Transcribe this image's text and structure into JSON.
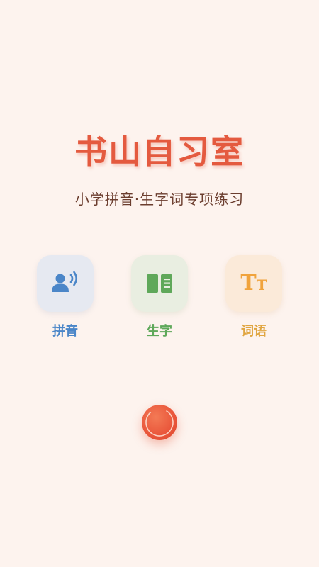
{
  "app": {
    "title": "书山自习室",
    "subtitle": "小学拼音·生字词专项练习"
  },
  "menu": {
    "items": [
      {
        "label": "拼音",
        "icon": "speaking-person-icon",
        "color": "#4b86c8"
      },
      {
        "label": "生字",
        "icon": "open-book-icon",
        "color": "#5fa85a"
      },
      {
        "label": "词语",
        "icon": "text-size-icon",
        "color": "#e0a540"
      }
    ]
  },
  "colors": {
    "background": "#fdf3ee",
    "title": "#e45a3f",
    "subtitle": "#6b3d2e",
    "record_button": "#e9553a"
  }
}
